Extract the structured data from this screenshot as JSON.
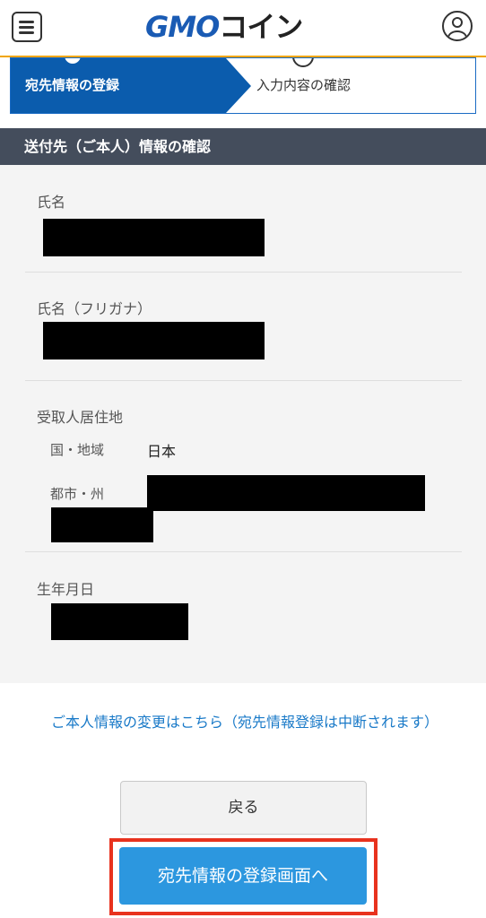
{
  "header": {
    "logo_gmo": "GMO",
    "logo_coin": "コイン",
    "menu_icon": "hamburger-menu-icon",
    "user_icon": "user-account-icon",
    "accent_color": "#f0a500"
  },
  "stepper": {
    "steps": [
      {
        "label": "宛先情報の登録",
        "state": "active"
      },
      {
        "label": "入力内容の確認",
        "state": "inactive"
      }
    ],
    "active_color": "#0b5cad"
  },
  "section": {
    "title": "送付先（ご本人）情報の確認"
  },
  "fields": {
    "name_label": "氏名",
    "kana_label": "氏名（フリガナ）",
    "address_label": "受取人居住地",
    "country_label": "国・地域",
    "country_value": "日本",
    "city_label": "都市・州",
    "birthdate_label": "生年月日"
  },
  "links": {
    "change_info": "ご本人情報の変更はこちら（宛先情報登録は中断されます）"
  },
  "buttons": {
    "back": "戻る",
    "to_registration": "宛先情報の登録画面へ",
    "primary_color": "#2c97df",
    "highlight_color": "#e8321e"
  }
}
